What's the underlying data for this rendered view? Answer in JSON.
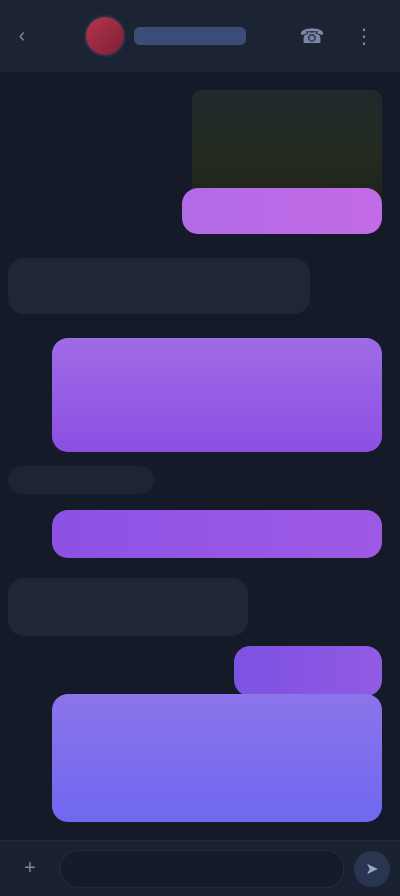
{
  "header": {
    "title": "",
    "back_icon": "chevron-left-icon",
    "call_icon": "phone-icon",
    "more_icon": "more-icon"
  },
  "messages": [
    {
      "id": "m1",
      "type": "media",
      "label": ""
    },
    {
      "id": "m2",
      "type": "text",
      "text": ""
    },
    {
      "id": "m3",
      "type": "text",
      "text": ""
    },
    {
      "id": "m4",
      "type": "text",
      "text": ""
    },
    {
      "id": "m5",
      "type": "text",
      "text": ""
    },
    {
      "id": "m6",
      "type": "text",
      "text": ""
    },
    {
      "id": "m7",
      "type": "text",
      "text": ""
    },
    {
      "id": "m8",
      "type": "text",
      "text": ""
    },
    {
      "id": "m9",
      "type": "text",
      "text": ""
    }
  ],
  "composer": {
    "placeholder": "",
    "attach_icon": "plus-icon",
    "send_icon": "send-icon"
  }
}
